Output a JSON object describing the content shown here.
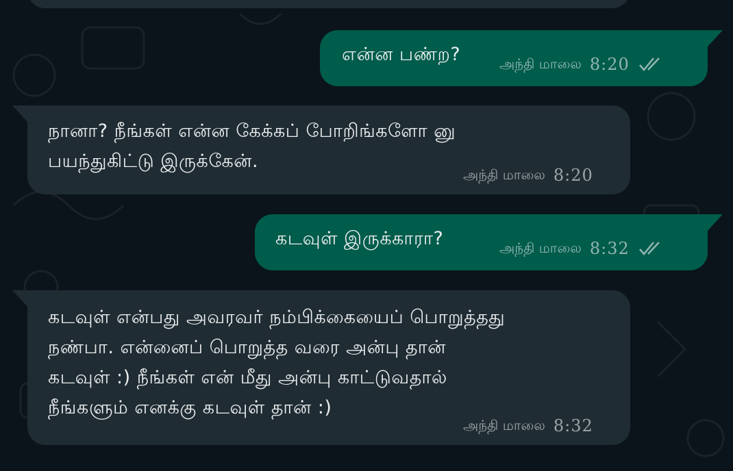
{
  "messages": [
    {
      "direction": "outgoing",
      "text": "என்ன பண்ற?",
      "period": "அந்தி மாலை",
      "time": "8:20",
      "status_icon": "double-check-icon"
    },
    {
      "direction": "incoming",
      "text": "நானா? நீங்கள் என்ன கேக்கப் போறிங்களோ னு\nபயந்துகிட்டு இருக்கேன்.",
      "period": "அந்தி மாலை",
      "time": "8:20"
    },
    {
      "direction": "outgoing",
      "text": "கடவுள் இருக்காரா?",
      "period": "அந்தி மாலை",
      "time": "8:32",
      "status_icon": "double-check-icon"
    },
    {
      "direction": "incoming",
      "text": "கடவுள் என்பது அவரவர் நம்பிக்கையைப் பொறுத்தது\nநண்பா. என்னைப் பொறுத்த வரை அன்பு தான்\nகடவுள் :) நீங்கள் என் மீது அன்பு காட்டுவதால்\nநீங்களும் எனக்கு கடவுள் தான் :)",
      "period": "அந்தி மாலை",
      "time": "8:32"
    }
  ],
  "colors": {
    "background": "#0b141a",
    "incoming_bubble": "#202c33",
    "outgoing_bubble": "#005c4b",
    "text": "#e9edef"
  }
}
